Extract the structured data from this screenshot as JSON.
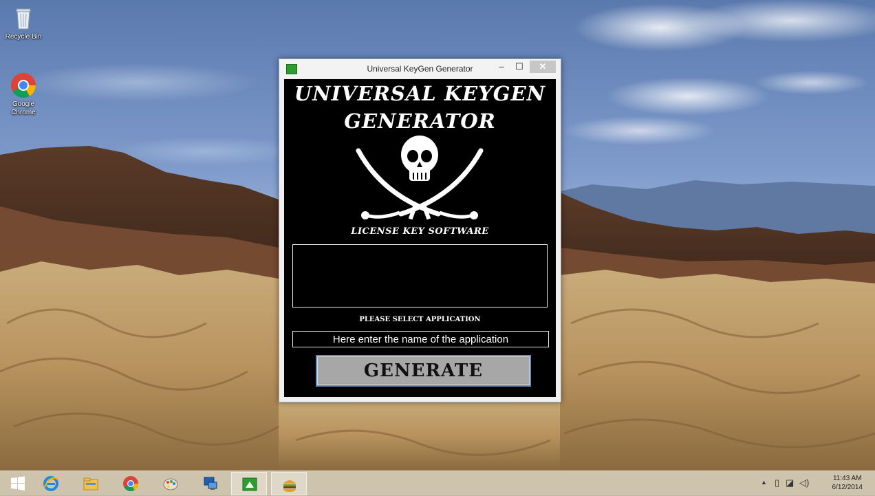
{
  "desktop": {
    "icons": [
      {
        "label": "Recycle Bin",
        "icon": "recycle-bin-icon"
      },
      {
        "label": "Google Chrome",
        "icon": "chrome-icon"
      }
    ]
  },
  "window": {
    "title": "Universal KeyGen Generator",
    "controls": {
      "minimize": "–",
      "maximize": "☐",
      "close": "✕"
    },
    "heading_line1": "UNIVERSAL KEYGEN",
    "heading_line2": "GENERATOR",
    "emblem": "skull-crossed-swords-icon",
    "subtitle": "LICENSE KEY SOFTWARE",
    "key_output": "",
    "select_label": "PLEASE SELECT APPLICATION",
    "app_input_value": "Here enter the name of the application",
    "generate_label": "GENERATE"
  },
  "taskbar": {
    "items": [
      {
        "icon": "windows-start-icon"
      },
      {
        "icon": "internet-explorer-icon"
      },
      {
        "icon": "file-explorer-icon"
      },
      {
        "icon": "chrome-icon"
      },
      {
        "icon": "paint-icon"
      },
      {
        "icon": "remote-desktop-icon"
      },
      {
        "icon": "keygen-app-icon"
      },
      {
        "icon": "burger-app-icon"
      }
    ],
    "tray_icons": [
      "show-hidden-icons",
      "battery-icon",
      "network-icon",
      "volume-icon"
    ],
    "tray_symbols": {
      "expand": "▲",
      "battery": "▯",
      "network": "◪",
      "volume": "◁)"
    },
    "clock_time": "11:43 AM",
    "clock_date": "6/12/2014"
  },
  "colors": {
    "window_client_bg": "#000000",
    "generate_bg": "#a7a7a7",
    "close_button_bg": "#c7c7c7"
  }
}
